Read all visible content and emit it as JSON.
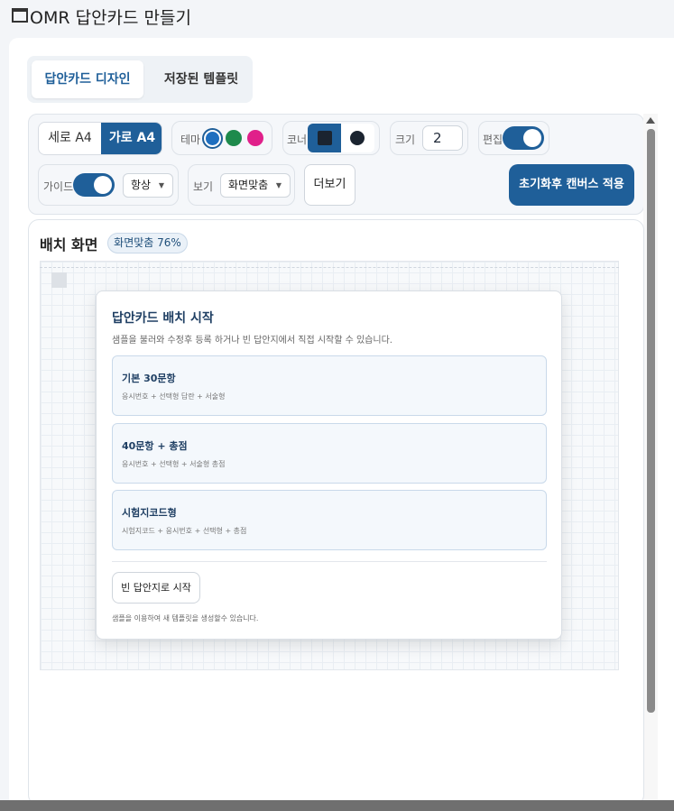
{
  "app": {
    "title": "OMR 답안카드 만들기"
  },
  "tabs": [
    {
      "label": "답안카드 디자인",
      "active": true
    },
    {
      "label": "저장된 템플릿",
      "active": false
    }
  ],
  "toolbar": {
    "orientation": {
      "options": [
        "세로 A4",
        "가로 A4"
      ],
      "selected": "가로 A4"
    },
    "theme": {
      "label": "테마",
      "colors": [
        "#1f6fbf",
        "#1e8a4c",
        "#e0208a"
      ],
      "selected": "#1f6fbf"
    },
    "corner": {
      "label": "코너"
    },
    "size": {
      "label": "크기",
      "value": "2"
    },
    "edit": {
      "label": "편집",
      "on": true
    },
    "guide": {
      "label": "가이드",
      "on": true,
      "mode": "항상"
    },
    "view": {
      "label": "보기",
      "mode": "화면맞춤"
    },
    "more_label": "더보기",
    "apply_label": "초기화후 캔버스 적용"
  },
  "layout": {
    "title": "배치 화면",
    "zoom_badge": "화면맞춤 76%"
  },
  "modal": {
    "title": "답안카드 배치 시작",
    "description": "샘플을 불러와 수정후 등록 하거나 빈 답안지에서 직접 시작할 수 있습니다.",
    "options": [
      {
        "title": "기본 30문항",
        "desc": "응시번호 + 선택형 답란 + 서술형"
      },
      {
        "title": "40문항 + 총점",
        "desc": "응시번호 + 선택형 + 서술형 총점"
      },
      {
        "title": "시험지코드형",
        "desc": "시험지코드 + 응시번호 + 선택형 + 총점"
      }
    ],
    "blank_button": "빈 답안지로 시작",
    "footer": "샘플을 이용하여 새 템플릿을 생성할수 있습니다."
  }
}
